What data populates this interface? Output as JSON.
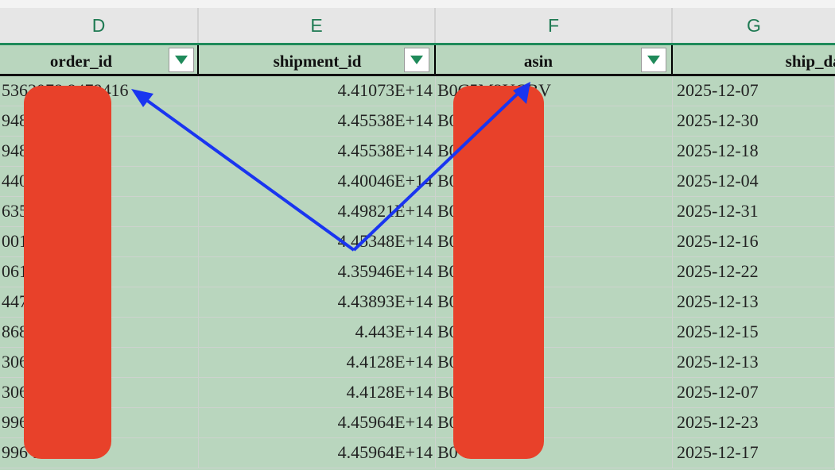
{
  "sheet": {
    "column_letters": [
      "D",
      "E",
      "F",
      "G"
    ],
    "headers": [
      "order_id",
      "shipment_id",
      "asin",
      "ship_date"
    ],
    "rows": [
      {
        "order_id": "5363078 8479416",
        "shipment_id": "4.41073E+14",
        "asin": "B0C5M2YCBV",
        "ship_date": "2025-12-07"
      },
      {
        "order_id": "948 033",
        "shipment_id": "4.45538E+14",
        "asin": "B0 SJ",
        "ship_date": "2025-12-30"
      },
      {
        "order_id": "948 033",
        "shipment_id": "4.45538E+14",
        "asin": "B0 SJ",
        "ship_date": "2025-12-18"
      },
      {
        "order_id": "440 660",
        "shipment_id": "4.40046E+14",
        "asin": "B0 BV",
        "ship_date": "2025-12-04"
      },
      {
        "order_id": "635 411",
        "shipment_id": "4.49821E+14",
        "asin": "B0 78",
        "ship_date": "2025-12-31"
      },
      {
        "order_id": "001 206",
        "shipment_id": "4.45348E+14",
        "asin": "B0 GDD",
        "ship_date": "2025-12-16"
      },
      {
        "order_id": "061 806",
        "shipment_id": "4.35946E+14",
        "asin": "B0 DT",
        "ship_date": "2025-12-22"
      },
      {
        "order_id": "447 255",
        "shipment_id": "4.43893E+14",
        "asin": "B0 YT",
        "ship_date": "2025-12-13"
      },
      {
        "order_id": "868 652",
        "shipment_id": "4.443E+14",
        "asin": "B0 M76",
        "ship_date": "2025-12-15"
      },
      {
        "order_id": "306 851",
        "shipment_id": "4.4128E+14",
        "asin": "B0 T",
        "ship_date": "2025-12-13"
      },
      {
        "order_id": "306 851",
        "shipment_id": "4.4128E+14",
        "asin": "B0 T",
        "ship_date": "2025-12-07"
      },
      {
        "order_id": "996 812",
        "shipment_id": "4.45964E+14",
        "asin": "B0 Y4",
        "ship_date": "2025-12-23"
      },
      {
        "order_id": "996 1812",
        "shipment_id": "4.45964E+14",
        "asin": "B0 Y4",
        "ship_date": "2025-12-17"
      }
    ]
  },
  "colors": {
    "column_letter": "#1f7a53",
    "header_accent": "#1f8a5a",
    "table_fill": "#b9d6be",
    "filter_arrow": "#1f8a5a",
    "redaction": "#e8412a",
    "annotation_arrow": "#1a35f0"
  },
  "icons": {
    "filter": "filter-dropdown-icon",
    "arrow": "annotation-arrow-icon"
  }
}
